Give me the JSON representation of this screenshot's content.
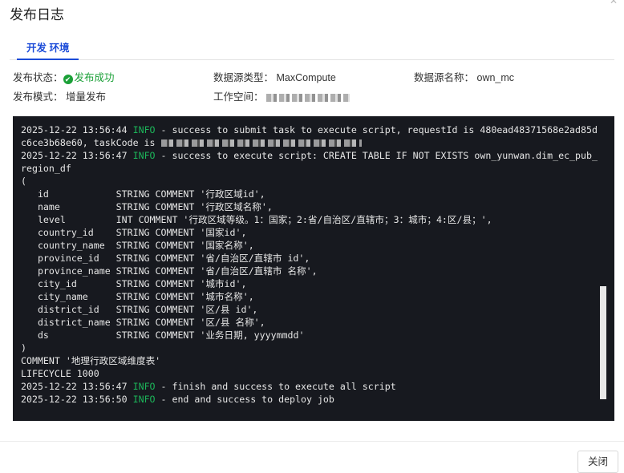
{
  "dialog": {
    "title": "发布日志",
    "close_label": "关闭"
  },
  "tabs": [
    {
      "label": "开发 环境",
      "active": true
    }
  ],
  "info": {
    "status_label": "发布状态：",
    "status_value": "发布成功",
    "ds_type_label": "数据源类型：",
    "ds_type_value": "MaxCompute",
    "ds_name_label": "数据源名称：",
    "ds_name_value": "own_mc",
    "mode_label": "发布模式：",
    "mode_value": "增量发布",
    "workspace_label": "工作空间："
  },
  "colors": {
    "accent": "#1b4bd8",
    "success": "#1aa037",
    "log_bg": "#17191f",
    "info_level": "#1cb65a"
  },
  "log": {
    "entries": [
      {
        "ts": "2025-12-22 13:56:44",
        "level": "INFO",
        "msg": " - success to submit task to execute script, requestId is 480ead48371568e2ad85d\nc6ce3b68e60, taskCode is "
      },
      {
        "ts": "2025-12-22 13:56:47",
        "level": "INFO",
        "msg": " - success to execute script: CREATE TABLE IF NOT EXISTS own_yunwan.dim_ec_pub_\nregion_df\n(\n   id            STRING COMMENT '行政区域id',\n   name          STRING COMMENT '行政区域名称',\n   level         INT COMMENT '行政区域等级。1：国家；2:省/自治区/直辖市；3：城市；4:区/县；',\n   country_id    STRING COMMENT '国家id',\n   country_name  STRING COMMENT '国家名称',\n   province_id   STRING COMMENT '省/自治区/直辖市 id',\n   province_name STRING COMMENT '省/自治区/直辖市 名称',\n   city_id       STRING COMMENT '城市id',\n   city_name     STRING COMMENT '城市名称',\n   district_id   STRING COMMENT '区/县 id',\n   district_name STRING COMMENT '区/县 名称',\n   ds            STRING COMMENT '业务日期, yyyymmdd'\n)\nCOMMENT '地理行政区域维度表'\nLIFECYCLE 1000"
      },
      {
        "ts": "2025-12-22 13:56:47",
        "level": "INFO",
        "msg": " - finish and success to execute all script"
      },
      {
        "ts": "2025-12-22 13:56:50",
        "level": "INFO",
        "msg": " - end and success to deploy job"
      }
    ]
  }
}
